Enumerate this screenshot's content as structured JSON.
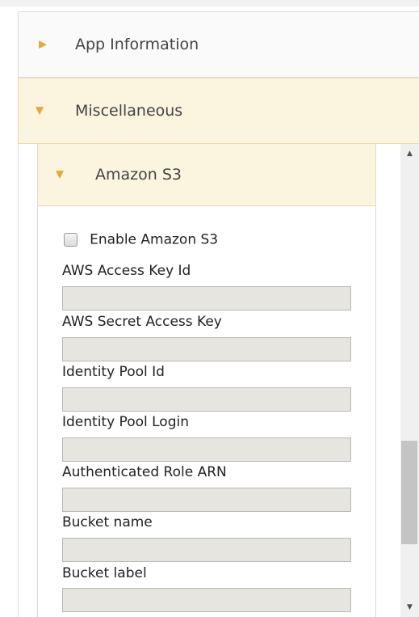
{
  "accordion": {
    "app_information": {
      "label": "App Information",
      "arrow_icon": "triangle-right-icon"
    },
    "miscellaneous": {
      "label": "Miscellaneous",
      "arrow_icon": "triangle-down-icon"
    }
  },
  "amazon_s3": {
    "header_label": "Amazon S3",
    "arrow_icon": "triangle-down-icon",
    "enable_checkbox": {
      "label": "Enable Amazon S3",
      "checked": false
    },
    "fields": [
      {
        "label": "AWS Access Key Id",
        "value": ""
      },
      {
        "label": "AWS Secret Access Key",
        "value": ""
      },
      {
        "label": "Identity Pool Id",
        "value": ""
      },
      {
        "label": "Identity Pool Login",
        "value": ""
      },
      {
        "label": "Authenticated Role ARN",
        "value": ""
      },
      {
        "label": "Bucket name",
        "value": ""
      },
      {
        "label": "Bucket label",
        "value": ""
      }
    ]
  },
  "colors": {
    "accent_arrow": "#e3a93a",
    "active_header_bg": "#fbf4df",
    "input_bg": "#e6e5e0"
  }
}
